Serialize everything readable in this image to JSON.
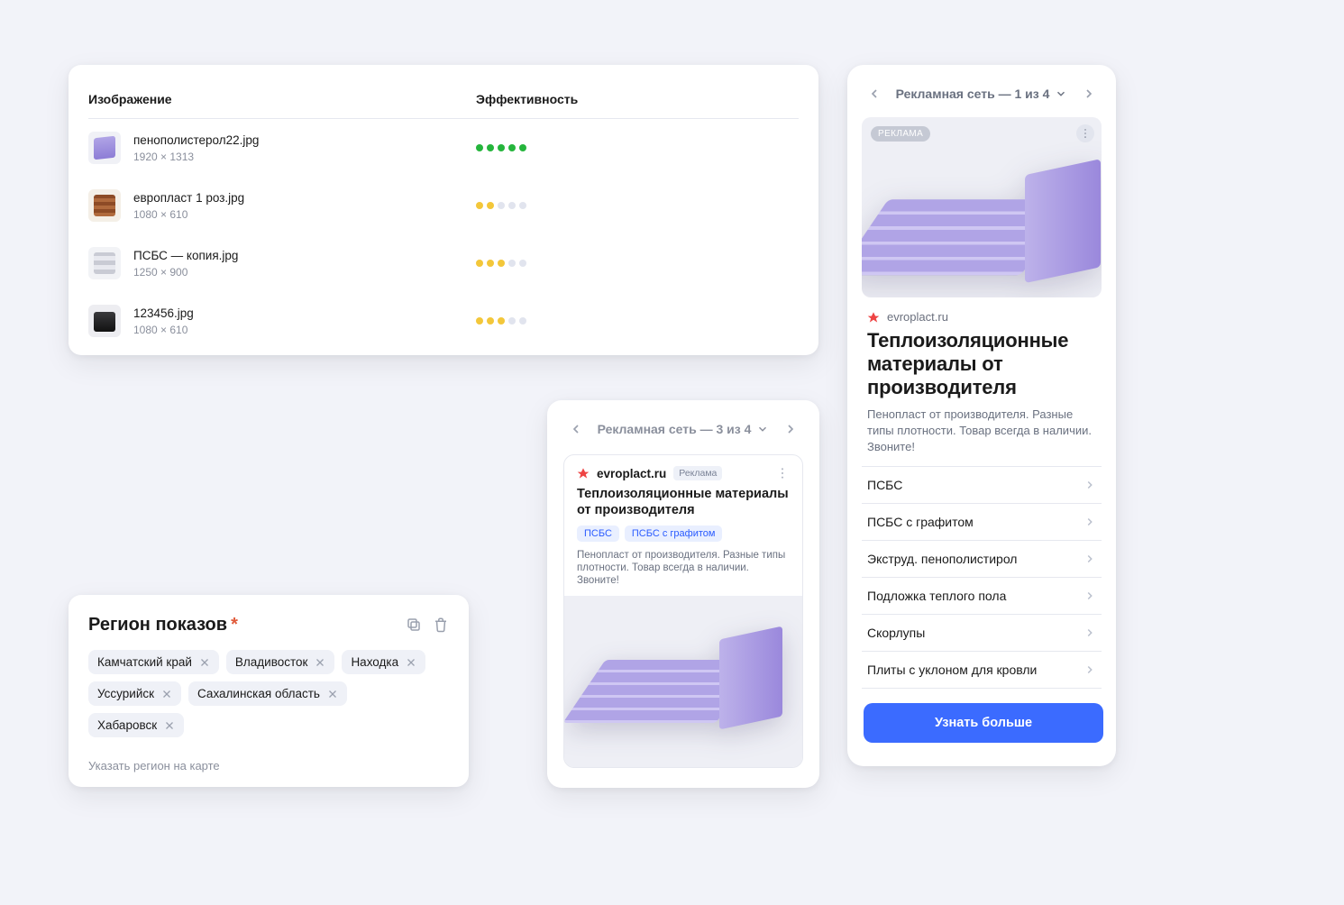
{
  "images": {
    "headers": {
      "image": "Изображение",
      "eff": "Эффективность"
    },
    "rows": [
      {
        "name": "пенополистерол22.jpg",
        "dim": "1920 × 1313",
        "rating": [
          1,
          1,
          1,
          1,
          1
        ]
      },
      {
        "name": "европласт 1 роз.jpg",
        "dim": "1080 × 610",
        "rating": [
          2,
          2,
          0,
          0,
          0
        ]
      },
      {
        "name": "ПСБС — копия.jpg",
        "dim": "1250 × 900",
        "rating": [
          2,
          2,
          2,
          0,
          0
        ]
      },
      {
        "name": "123456.jpg",
        "dim": "1080 × 610",
        "rating": [
          2,
          2,
          2,
          0,
          0
        ]
      }
    ]
  },
  "region": {
    "title": "Регион показов",
    "tags": [
      "Камчатский край",
      "Владивосток",
      "Находка",
      "Уссурийск",
      "Сахалинская область",
      "Хабаровск"
    ],
    "map_link": "Указать регион на карте"
  },
  "small_ad": {
    "pager": "Рекламная сеть — 3 из 4",
    "domain": "evroplact.ru",
    "ad_label": "Реклама",
    "title": "Теплоизоляционные материалы от производителя",
    "tag1": "ПСБС",
    "tag2": "ПСБС с графитом",
    "desc": "Пенопласт от производителя. Разные типы плотности. Товар всегда в наличии. Звоните!"
  },
  "large_ad": {
    "pager": "Рекламная сеть — 1 из 4",
    "badge": "РЕКЛАМА",
    "domain": "evroplact.ru",
    "title": "Теплоизоляционные материалы от производителя",
    "desc": "Пенопласт от производителя. Разные типы плотности. Товар всегда в наличии. Звоните!",
    "links": [
      "ПСБС",
      "ПСБС с графитом",
      "Экструд. пенополистирол",
      "Подложка теплого пола",
      "Скорлупы",
      "Плиты с уклоном для кровли"
    ],
    "cta": "Узнать больше"
  }
}
